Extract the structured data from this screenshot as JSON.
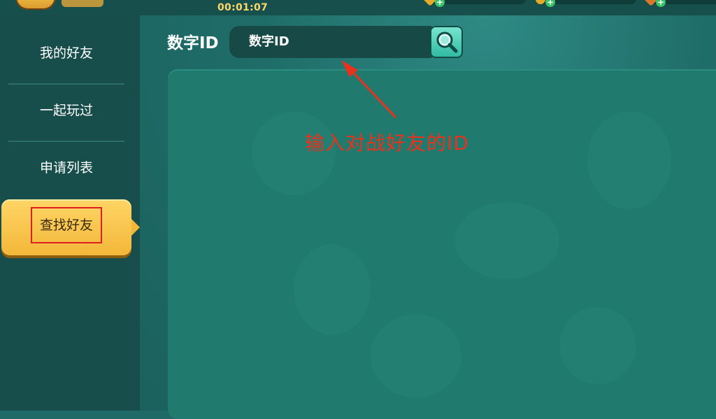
{
  "topbar": {
    "timer": "00:01:07",
    "resources": [
      {
        "icon": "gem-icon",
        "plus": "+"
      },
      {
        "icon": "coin-icon",
        "plus": "+"
      },
      {
        "icon": "ticket-icon",
        "plus": "+"
      }
    ]
  },
  "sidebar": {
    "items": [
      {
        "label": "我的好友",
        "active": false
      },
      {
        "label": "一起玩过",
        "active": false
      },
      {
        "label": "申请列表",
        "active": false
      },
      {
        "label": "查找好友",
        "active": true
      }
    ]
  },
  "search": {
    "label": "数字ID",
    "placeholder": "数字ID",
    "button_icon": "search-icon"
  },
  "annotation": {
    "text": "输入对战好友的ID",
    "color": "#e8321e"
  },
  "colors": {
    "accent_yellow": "#f2b739",
    "panel_teal": "#207a6d",
    "sidebar": "#174e4b",
    "search_button": "#2eb9a0"
  }
}
